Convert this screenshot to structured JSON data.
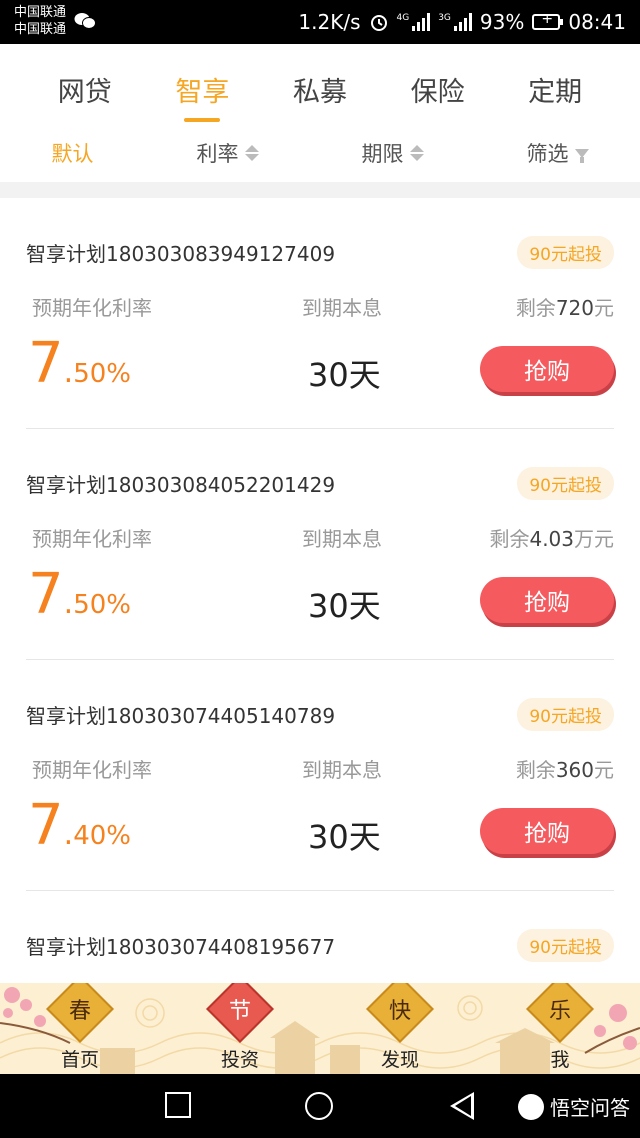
{
  "status_bar": {
    "carrier_1": "中国联通",
    "carrier_2": "中国联通",
    "net_speed": "1.2K/s",
    "network_1": "4G",
    "network_2": "3G",
    "battery": "93%",
    "time": "08:41"
  },
  "tabs": [
    {
      "label": "网贷",
      "active": false
    },
    {
      "label": "智享",
      "active": true
    },
    {
      "label": "私募",
      "active": false
    },
    {
      "label": "保险",
      "active": false
    },
    {
      "label": "定期",
      "active": false
    }
  ],
  "sort": {
    "default_label": "默认",
    "rate_label": "利率",
    "term_label": "期限",
    "filter_label": "筛选"
  },
  "products": [
    {
      "name": "智享计划180303083949127409",
      "min_invest": "90元起投",
      "rate_label": "预期年化利率",
      "term_label": "到期本息",
      "remain_prefix": "剩余",
      "remain_amount": "720",
      "remain_unit": "元",
      "rate_int": "7",
      "rate_dec": "50%",
      "term": "30天",
      "button": "抢购"
    },
    {
      "name": "智享计划180303084052201429",
      "min_invest": "90元起投",
      "rate_label": "预期年化利率",
      "term_label": "到期本息",
      "remain_prefix": "剩余",
      "remain_amount": "4.03",
      "remain_unit": "万元",
      "rate_int": "7",
      "rate_dec": "50%",
      "term": "30天",
      "button": "抢购"
    },
    {
      "name": "智享计划180303074405140789",
      "min_invest": "90元起投",
      "rate_label": "预期年化利率",
      "term_label": "到期本息",
      "remain_prefix": "剩余",
      "remain_amount": "360",
      "remain_unit": "元",
      "rate_int": "7",
      "rate_dec": "40%",
      "term": "30天",
      "button": "抢购"
    },
    {
      "name": "智享计划180303074408195677",
      "min_invest": "90元起投"
    }
  ],
  "bottom_nav": [
    {
      "badge": "春",
      "label": "首页"
    },
    {
      "badge": "节",
      "label": "投资"
    },
    {
      "badge": "快",
      "label": "发现"
    },
    {
      "badge": "乐",
      "label": "我"
    }
  ],
  "watermark": "悟空问答",
  "colors": {
    "accent": "#f5a623",
    "rate": "#f5821f",
    "buy_button": "#f55a5e",
    "nav_bg": "#fcefd2"
  }
}
